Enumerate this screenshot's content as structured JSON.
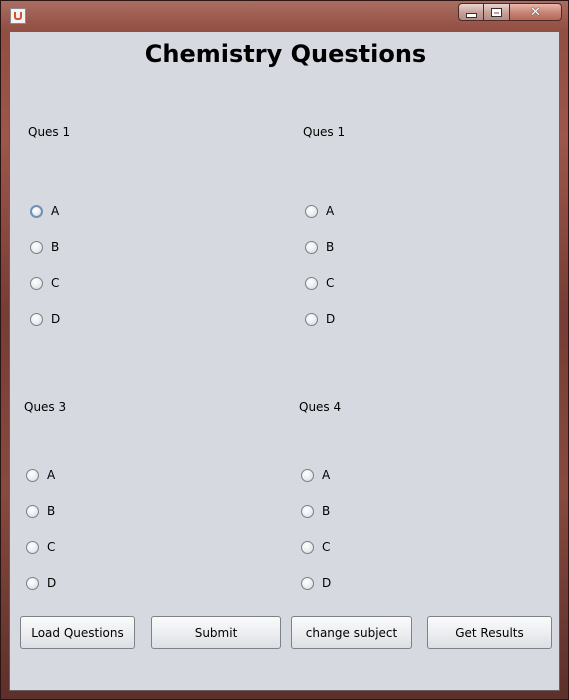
{
  "window": {
    "title": "",
    "controls": {
      "minimize": "minimize",
      "maximize": "maximize",
      "close": "close"
    }
  },
  "header": {
    "title": "Chemistry Questions"
  },
  "questions": [
    {
      "label": "Ques 1",
      "options": [
        "A",
        "B",
        "C",
        "D"
      ]
    },
    {
      "label": "Ques 1",
      "options": [
        "A",
        "B",
        "C",
        "D"
      ]
    },
    {
      "label": "Ques 3",
      "options": [
        "A",
        "B",
        "C",
        "D"
      ]
    },
    {
      "label": "Ques 4",
      "options": [
        "A",
        "B",
        "C",
        "D"
      ]
    }
  ],
  "buttons": {
    "load": "Load Questions",
    "submit": "Submit",
    "change_subject": "change subject",
    "results": "Get Results"
  },
  "icons": {
    "app": "java-cup-icon"
  }
}
